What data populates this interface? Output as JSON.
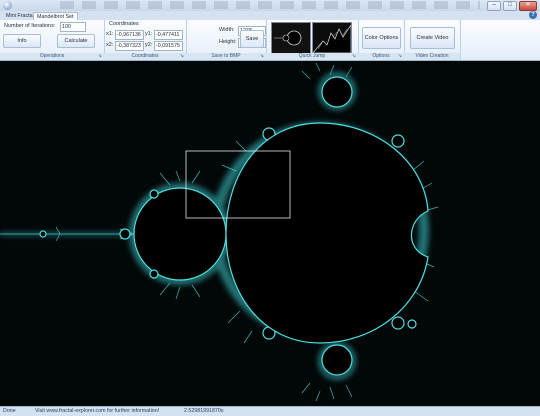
{
  "titlebar": {
    "title": "",
    "minimize": "–",
    "maximize": "□",
    "close": "✕"
  },
  "tabs": [
    "Mini Fractal",
    "Mandelbrot Set"
  ],
  "help": "?",
  "groups": {
    "operations": {
      "caption": "Operations",
      "iterations_label": "Number of Iterations:",
      "iterations_value": "100",
      "info_label": "Info",
      "calculate_label": "Calculate"
    },
    "coordinates": {
      "caption": "Coordinates",
      "title": "Coordinates",
      "x1_label": "x1:",
      "x1_value": "-0,967136",
      "y1_label": "y1:",
      "y1_value": "-0,477411",
      "x2_label": "x2:",
      "x2_value": "-0,387323",
      "y2_label": "y2:",
      "y2_value": "-0,091575"
    },
    "save": {
      "caption": "Save to BMP",
      "width_label": "Width:",
      "width_value": "1278",
      "height_label": "Height:",
      "height_value": "819",
      "save_label": "Save"
    },
    "quickjump": {
      "caption": "Quick Jump"
    },
    "options": {
      "caption": "Options",
      "color_label": "Color Options"
    },
    "video": {
      "caption": "Video Creation",
      "create_label": "Create Video"
    }
  },
  "status": {
    "state": "Done",
    "link": "Visit www.fractal-explorer.com for further information!",
    "time": "2.52981991870s"
  },
  "colors": {
    "accent_glow": "#4fe0e0",
    "canvas_bg": "#020708"
  }
}
